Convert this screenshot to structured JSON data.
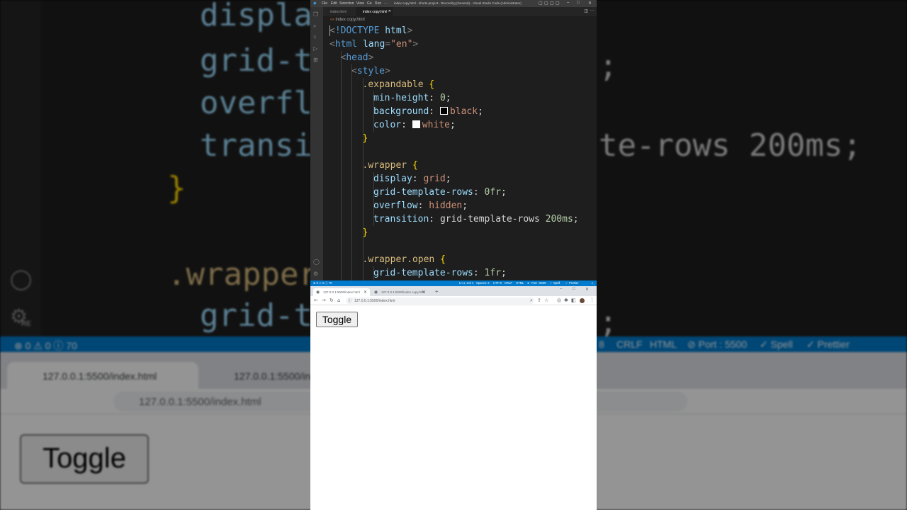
{
  "background": {
    "code_lines": [
      "display",
      "grid-te",
      "overflo",
      "transit",
      "}",
      ".wrapper",
      "grid-te"
    ],
    "right_fragments": [
      ";",
      "te-rows 200ms;",
      ";"
    ],
    "status": [
      "⊗ 0 ⚠ 0 ⓘ 70",
      "8",
      "CRLF",
      "HTML",
      "⊘ Port : 5500",
      "✓ Spell",
      "✓ Prettier"
    ],
    "tabs": [
      "127.0.0.1:5500/index.html",
      "127.0.0.1:5500/index"
    ],
    "url": "127.0.0.1:5500/index.html",
    "toggle": "Toggle",
    "settings_badge": "RE"
  },
  "vscode": {
    "menu": [
      "File",
      "Edit",
      "Selection",
      "View",
      "Go",
      "Run",
      "···"
    ],
    "title": "index copy.html - shorts-project - Recording (General) - Visual Studio Code (Administrator)",
    "tabs": [
      {
        "label": "index.html",
        "active": false
      },
      {
        "label": "index copy.html",
        "active": true
      }
    ],
    "breadcrumb": "index copy.html",
    "status": {
      "problems": "⊗ 0 ⚠ 0 ⓘ 70",
      "position": "Ln 1, Col 1",
      "spaces": "Spaces: 2",
      "encoding": "UTF-8",
      "eol": "CRLF",
      "language": "HTML",
      "port": "Port : 5500",
      "spell": "Spell",
      "prettier": "Prettier"
    }
  },
  "code": [
    {
      "indent": 0,
      "parts": [
        [
          "tg",
          "<"
        ],
        [
          "tn",
          "!DOCTYPE"
        ],
        [
          "at",
          " html"
        ],
        [
          "tg",
          ">"
        ]
      ]
    },
    {
      "indent": 0,
      "parts": [
        [
          "tg",
          "<"
        ],
        [
          "tn",
          "html"
        ],
        [
          "at",
          " lang"
        ],
        [
          "tg",
          "="
        ],
        [
          "sv",
          "\"en\""
        ],
        [
          "tg",
          ">"
        ]
      ]
    },
    {
      "indent": 1,
      "parts": [
        [
          "tg",
          "<"
        ],
        [
          "tn",
          "head"
        ],
        [
          "tg",
          ">"
        ]
      ]
    },
    {
      "indent": 2,
      "parts": [
        [
          "tg",
          "<"
        ],
        [
          "tn",
          "style"
        ],
        [
          "tg",
          ">"
        ]
      ]
    },
    {
      "indent": 3,
      "parts": [
        [
          "sel",
          ".expandable"
        ],
        [
          "br",
          " {"
        ]
      ]
    },
    {
      "indent": 4,
      "parts": [
        [
          "pr",
          "min-height"
        ],
        [
          "tx",
          ": "
        ],
        [
          "nm",
          "0"
        ],
        [
          "tx",
          ";"
        ]
      ]
    },
    {
      "indent": 4,
      "parts": [
        [
          "pr",
          "background"
        ],
        [
          "tx",
          ": "
        ],
        [
          "swk",
          ""
        ],
        [
          "vl",
          "black"
        ],
        [
          "tx",
          ";"
        ]
      ]
    },
    {
      "indent": 4,
      "parts": [
        [
          "pr",
          "color"
        ],
        [
          "tx",
          ": "
        ],
        [
          "sww",
          ""
        ],
        [
          "vl",
          "white"
        ],
        [
          "tx",
          ";"
        ]
      ]
    },
    {
      "indent": 3,
      "parts": [
        [
          "br",
          "}"
        ]
      ]
    },
    {
      "indent": 0,
      "parts": []
    },
    {
      "indent": 3,
      "parts": [
        [
          "sel",
          ".wrapper"
        ],
        [
          "br",
          " {"
        ]
      ]
    },
    {
      "indent": 4,
      "parts": [
        [
          "pr",
          "display"
        ],
        [
          "tx",
          ": "
        ],
        [
          "vl",
          "grid"
        ],
        [
          "tx",
          ";"
        ]
      ]
    },
    {
      "indent": 4,
      "parts": [
        [
          "pr",
          "grid-template-rows"
        ],
        [
          "tx",
          ": "
        ],
        [
          "nm",
          "0fr"
        ],
        [
          "tx",
          ";"
        ]
      ]
    },
    {
      "indent": 4,
      "parts": [
        [
          "pr",
          "overflow"
        ],
        [
          "tx",
          ": "
        ],
        [
          "vl",
          "hidden"
        ],
        [
          "tx",
          ";"
        ]
      ]
    },
    {
      "indent": 4,
      "parts": [
        [
          "pr",
          "transition"
        ],
        [
          "tx",
          ": "
        ],
        [
          "tx",
          "grid-template-rows "
        ],
        [
          "nm",
          "200ms"
        ],
        [
          "tx",
          ";"
        ]
      ]
    },
    {
      "indent": 3,
      "parts": [
        [
          "br",
          "}"
        ]
      ]
    },
    {
      "indent": 0,
      "parts": []
    },
    {
      "indent": 3,
      "parts": [
        [
          "sel",
          ".wrapper.open"
        ],
        [
          "br",
          " {"
        ]
      ]
    },
    {
      "indent": 4,
      "parts": [
        [
          "pr",
          "grid-template-rows"
        ],
        [
          "tx",
          ": "
        ],
        [
          "nm",
          "1fr"
        ],
        [
          "tx",
          ";"
        ]
      ]
    }
  ],
  "chrome": {
    "tabs": [
      {
        "label": "127.0.0.1:5500/index.html",
        "active": true
      },
      {
        "label": "127.0.0.1:5500/index copy.html",
        "active": false
      }
    ],
    "url": "127.0.0.1:5500/index.html",
    "toggle_label": "Toggle"
  },
  "colors": {
    "accent": "#007acc",
    "editor_bg": "#1e1e1e"
  }
}
